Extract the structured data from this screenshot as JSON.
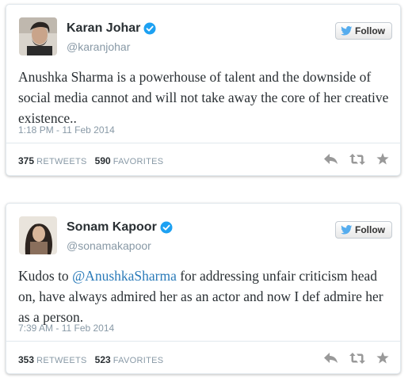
{
  "colors": {
    "text": "#292f33",
    "muted": "#8899a6",
    "link": "#2b7bb9",
    "verified": "#1da1f2",
    "border": "#e1e8ed",
    "icon": "#999999"
  },
  "tweets": [
    {
      "author": {
        "name": "Karan Johar",
        "handle": "@karanjohar",
        "verified": true
      },
      "follow_label": "Follow",
      "text": "Anushka Sharma is a powerhouse of talent and the downside of social media cannot and will not take away the core of her creative existence..",
      "timestamp": "1:18 PM - 11 Feb 2014",
      "retweets": "375",
      "retweets_label": "RETWEETS",
      "favorites": "590",
      "favorites_label": "FAVORITES",
      "icons": [
        "reply-icon",
        "retweet-icon",
        "favorite-icon"
      ]
    },
    {
      "author": {
        "name": "Sonam Kapoor",
        "handle": "@sonamakapoor",
        "verified": true
      },
      "follow_label": "Follow",
      "text_before": "Kudos to ",
      "mention": "@AnushkaSharma",
      "text_after": " for addressing unfair criticism head on, have always admired her as an actor and now I def admire her as a person.",
      "timestamp": "7:39 AM - 11 Feb 2014",
      "retweets": "353",
      "retweets_label": "RETWEETS",
      "favorites": "523",
      "favorites_label": "FAVORITES",
      "icons": [
        "reply-icon",
        "retweet-icon",
        "favorite-icon"
      ]
    }
  ]
}
